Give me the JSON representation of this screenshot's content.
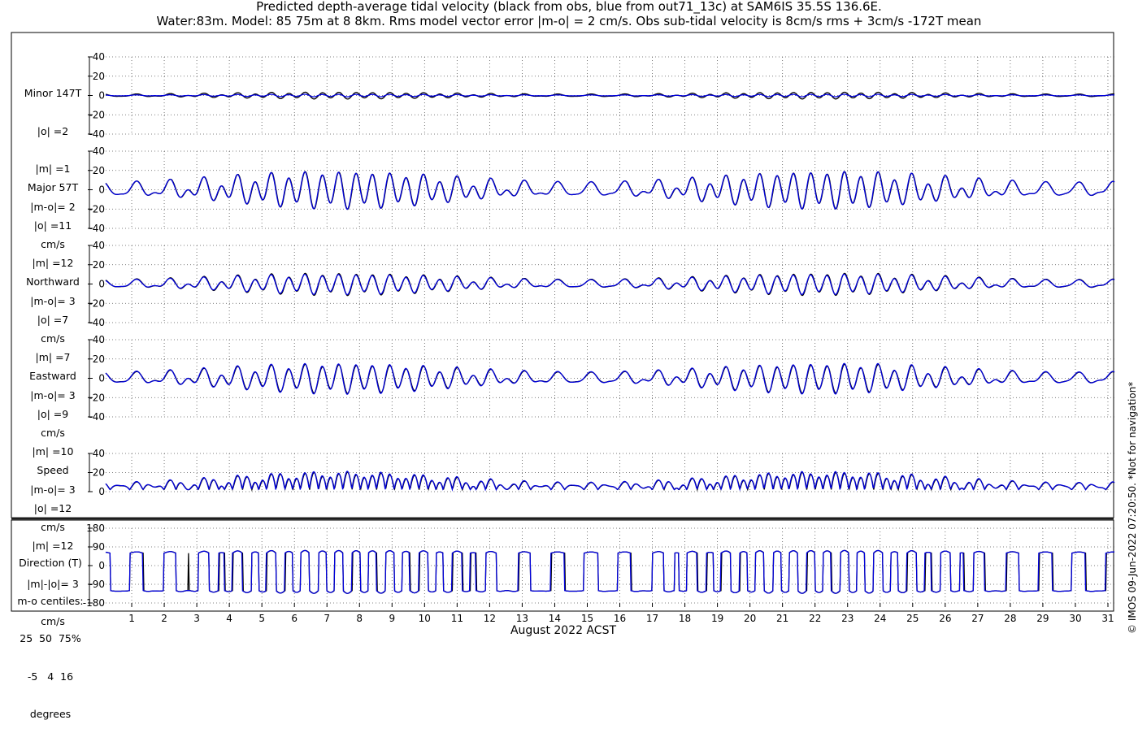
{
  "title": {
    "line1": "Predicted depth-average tidal velocity (black from obs, blue from out71_13c) at SAM6IS 35.5S 136.6E.",
    "line2": "Water:83m. Model: 85 75m at 8 8km. Rms model vector error |m-o| = 2 cm/s. Obs sub-tidal velocity is 8cm/s rms + 3cm/s -172T mean"
  },
  "credit": "© IMOS 09-Jun-2022 07:20:50. *Not for navigation*",
  "colors": {
    "obs": "#000000",
    "model": "#0000dd"
  },
  "chart_data": {
    "type": "line",
    "xlabel": "August 2022 ACST",
    "x_ticks": [
      1,
      2,
      3,
      4,
      5,
      6,
      7,
      8,
      9,
      10,
      11,
      12,
      13,
      14,
      15,
      16,
      17,
      18,
      19,
      20,
      21,
      22,
      23,
      24,
      25,
      26,
      27,
      28,
      29,
      30,
      31
    ],
    "xlim": [
      0.2,
      31.2
    ],
    "series_legend": [
      "black from obs",
      "blue from out71_13c"
    ],
    "panels": [
      {
        "name": "minor",
        "label": [
          "Minor 147T",
          "|o| =2",
          "|m| =1",
          "|m-o|= 2",
          "cm/s"
        ],
        "ylim": [
          -40,
          40
        ],
        "yticks": [
          -40,
          -20,
          0,
          20,
          40
        ],
        "ytick_labels": [
          "-40",
          "-20",
          "0",
          "20",
          "40"
        ],
        "grid": true,
        "obs_amp": 4,
        "model_amp": 1.5
      },
      {
        "name": "major",
        "label": [
          "Major 57T",
          "|o| =11",
          "|m| =12",
          "|m-o|= 3",
          "cm/s"
        ],
        "ylim": [
          -40,
          40
        ],
        "yticks": [
          -40,
          -20,
          0,
          20,
          40
        ],
        "ytick_labels": [
          "-40",
          "-20",
          "0",
          "20",
          "40"
        ],
        "grid": true,
        "obs_amp": 22,
        "model_amp": 22
      },
      {
        "name": "northward",
        "label": [
          "Northward",
          "|o| =7",
          "|m| =7",
          "|m-o|= 3",
          "cm/s"
        ],
        "ylim": [
          -40,
          40
        ],
        "yticks": [
          -40,
          -20,
          0,
          20,
          40
        ],
        "ytick_labels": [
          "-40",
          "-20",
          "0",
          "20",
          "40"
        ],
        "grid": true,
        "obs_amp": 13,
        "model_amp": 12
      },
      {
        "name": "eastward",
        "label": [
          "Eastward",
          "|o| =9",
          "|m| =10",
          "|m-o|= 3",
          "cm/s"
        ],
        "ylim": [
          -40,
          40
        ],
        "yticks": [
          -40,
          -20,
          0,
          20,
          40
        ],
        "ytick_labels": [
          "-40",
          "-20",
          "0",
          "20",
          "40"
        ],
        "grid": true,
        "obs_amp": 17,
        "model_amp": 18
      },
      {
        "name": "speed",
        "label": [
          "Speed",
          "|o| =12",
          "|m| =12",
          "|m|-|o|= 3",
          "cm/s"
        ],
        "ylim": [
          0,
          40
        ],
        "yticks": [
          0,
          20,
          40
        ],
        "ytick_labels": [
          "0",
          "20",
          "40"
        ],
        "grid": true,
        "obs_amp": 20,
        "model_amp": 21
      },
      {
        "name": "direction",
        "label": [
          "Direction (T)",
          "m-o centiles:",
          "25  50  75%",
          "-5   4  16",
          "degrees"
        ],
        "ylim": [
          -180,
          180
        ],
        "yticks": [
          -180,
          -90,
          0,
          90,
          180
        ],
        "ytick_labels": [
          "-180",
          "-90",
          "0",
          "90",
          "180"
        ],
        "grid": true,
        "obs_amp": 60,
        "model_amp": 60
      }
    ]
  }
}
